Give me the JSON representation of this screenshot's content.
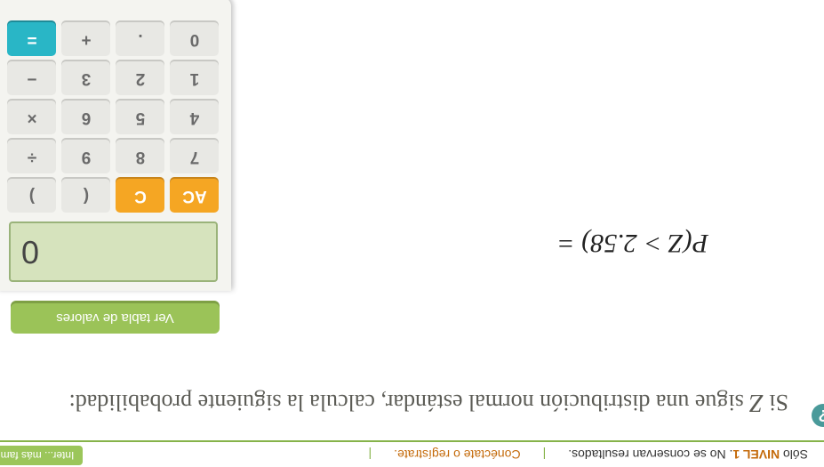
{
  "topbar": {
    "pre": "Sólo ",
    "nivel": "NIVEL 1",
    "rest": ". No se conservan resultados.",
    "connect": "Conéctate o regístrate.",
    "learn": "Inter... más familias"
  },
  "question": {
    "p1": "Si ",
    "zvar": "Z",
    "p2": " sigue una distribución normal estándar, calcula la siguiente probabilidad:"
  },
  "equation": "P(Z > 2.58) =",
  "tabla_btn": "Ver tabla de valores",
  "calc": {
    "display": "0",
    "keys": [
      {
        "id": "ac",
        "label": "AC",
        "cls": "orange"
      },
      {
        "id": "c",
        "label": "C",
        "cls": "orange"
      },
      {
        "id": "lp",
        "label": "(",
        "cls": ""
      },
      {
        "id": "rp",
        "label": ")",
        "cls": ""
      },
      {
        "id": "k7",
        "label": "7",
        "cls": ""
      },
      {
        "id": "k8",
        "label": "8",
        "cls": ""
      },
      {
        "id": "k9",
        "label": "9",
        "cls": ""
      },
      {
        "id": "div",
        "label": "÷",
        "cls": ""
      },
      {
        "id": "k4",
        "label": "4",
        "cls": ""
      },
      {
        "id": "k5",
        "label": "5",
        "cls": ""
      },
      {
        "id": "k6",
        "label": "6",
        "cls": ""
      },
      {
        "id": "mul",
        "label": "×",
        "cls": ""
      },
      {
        "id": "k1",
        "label": "1",
        "cls": ""
      },
      {
        "id": "k2",
        "label": "2",
        "cls": ""
      },
      {
        "id": "k3",
        "label": "3",
        "cls": ""
      },
      {
        "id": "sub",
        "label": "−",
        "cls": ""
      },
      {
        "id": "k0",
        "label": "0",
        "cls": ""
      },
      {
        "id": "dot",
        "label": ".",
        "cls": ""
      },
      {
        "id": "add",
        "label": "+",
        "cls": ""
      },
      {
        "id": "eq",
        "label": "=",
        "cls": "teal"
      }
    ]
  },
  "help": "?"
}
